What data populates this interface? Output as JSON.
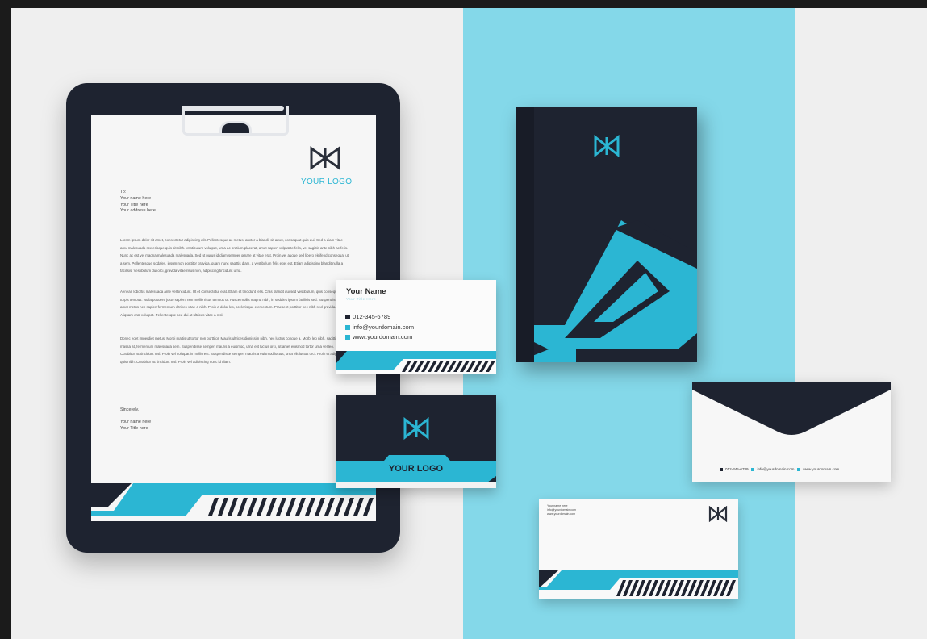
{
  "letterhead": {
    "logo_text": "YOUR LOGO",
    "to": "To:",
    "recipient_name": "Your name here",
    "recipient_title": "Your Title here",
    "recipient_address": "Your address here",
    "paragraph_1": "Lorem ipsum dolor sit amet, consectetur adipiscing elit. Pellentesque ac metus, auctor a blandit sit amet, consequat quis dui. Sed a diam vitae arcu malesuada scelerisque quis sit nibh. Vestibulum volutpat, urna ac pretium placerat, amet sapien vulputate felis, vel sagittis ante nibh ac felis. Nunc ac est vel magna malesuada malesuada. Sed ut purus id diam semper ornare at vitae erat. Proin vel augue sed libero eleifend consequat ut a sem. Pellentesque sodales, ipsum non porttitor gravida, quam nunc sagittis diam, a vestibulum felis eget est. Etiam adipiscing blandit nulla a facilisis. Vestibulum dui orci, gravida vitae risus non, adipiscing tincidunt urna.",
    "paragraph_2": "Aenean lobortis malesuada ante vel tincidunt. Ut et consectetur erat. Etiam et tincidunt felis. Cras blandit dui sed vestibulum, quis consequat turpis tempus. Nulla posuere justo sapien, non mollis risus tempus ut. Fusce mollis magna nibh, in sodales ipsum facilisis sed. Suspendisse sit amet metus nec sapien fermentum ultrices vitae a nibh. Proin a dolor leo, scelerisque elementum. Praesent porttitor nec nibh sed gravida. Aliquam erat volutpat. Pellentesque sed dui at ultrices vitae a nisl.",
    "paragraph_3": "Donec eget imperdiet metus. Morbi mattis ut tortor non porttitor. Mauris ultrices dignissim nibh, nec luctus congue a. Morbi leo nibh, sagittis ac massa at, fermentum malesuada sem. Suspendisse semper, mauris a euismod, urna elit luctus orci, sit amet euismod tortor urna vel leo. Curabitur ac tincidunt nisl. Proin vel volutpat in mollis est. Suspendisse semper, mauris a euismod luctus, urna elit luctus orci. Proin et adipiscing quis nibh. Curabitur ac tincidunt nisl. Proin vel adipiscing nunc id diam.",
    "closing": "Sincerely,",
    "sign_name": "Your name here",
    "sign_title": "Your Title here"
  },
  "business_card_front": {
    "name": "Your Name",
    "title": "Your Title Here",
    "phone": "012-345-6789",
    "email": "info@yourdomain.com",
    "website": "www.yourdomain.com"
  },
  "business_card_back": {
    "logo_text": "YOUR LOGO"
  },
  "envelope": {
    "phone": "012-345-6789",
    "email": "info@yourdomain.com",
    "website": "www.yourdomain.com"
  },
  "envelope_small": {
    "line_1": "Your name here",
    "line_2": "info@yourdomain.com",
    "line_3": "www.yourdomain.com"
  },
  "colors": {
    "accent": "#2bb6d3",
    "dark": "#1e2330",
    "panel": "#84d8e9",
    "background": "#efefef"
  }
}
